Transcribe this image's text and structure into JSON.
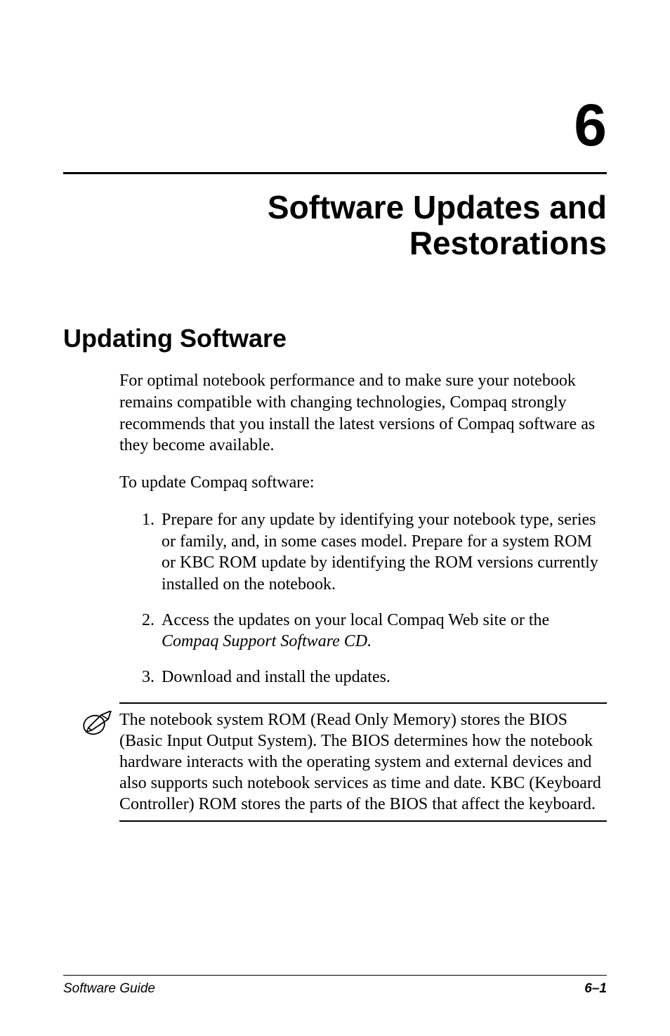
{
  "chapter": {
    "number": "6",
    "title_line1": "Software Updates and",
    "title_line2": "Restorations"
  },
  "section": {
    "heading": "Updating Software",
    "para1": "For optimal notebook performance and to make sure your notebook remains compatible with changing technologies, Compaq strongly recommends that you install the latest versions of Compaq software as they become available.",
    "para2": "To update Compaq software:",
    "list": [
      {
        "num": "1.",
        "text": "Prepare for any update by identifying your notebook type, series or family, and, in some cases model. Prepare for a system ROM or KBC ROM update by identifying the ROM versions currently installed on the notebook."
      },
      {
        "num": "2.",
        "text_pre": "Access the updates on your local Compaq Web site or the ",
        "text_italic": "Compaq Support Software CD."
      },
      {
        "num": "3.",
        "text": "Download and install the updates."
      }
    ],
    "note": "The notebook system ROM (Read Only Memory) stores the BIOS (Basic Input Output System). The BIOS determines how the notebook hardware interacts with the operating system and external devices and also supports such notebook services as time and date. KBC (Keyboard Controller) ROM stores the parts of the BIOS that affect the keyboard."
  },
  "footer": {
    "left": "Software Guide",
    "right": "6–1"
  },
  "icons": {
    "note": "note-pencil-icon"
  }
}
